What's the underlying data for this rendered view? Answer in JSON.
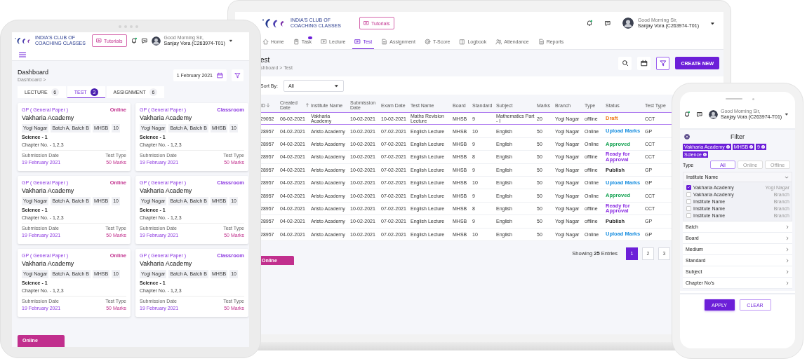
{
  "tablet": {
    "header": {
      "logo_text": [
        "INDIA'S CLUB OF",
        "COACHING CLASSES"
      ],
      "tutorials": "Tutorials",
      "greeting": "Good Morning Sir,",
      "user_name": "Sanjay Vora (C263974-T01)"
    },
    "page_title": "Dashboard",
    "breadcrumb": "Dashboard >",
    "date": "1 February 2021",
    "tabs": [
      {
        "label": "LECTURE",
        "count": "6",
        "selected": false
      },
      {
        "label": "TEST",
        "count": "3",
        "selected": true
      },
      {
        "label": "ASSIGNMENT",
        "count": "6",
        "selected": false
      }
    ],
    "cards": [
      {
        "paper": "GP ( General Paper )",
        "mode": "Online",
        "color": "#c12f8d",
        "title": "Vakharia Academy",
        "chips": [
          "Yogi Nagar",
          "Batch A, Batch B",
          "MHSB",
          "10"
        ],
        "subject": "Science - 1",
        "chapter": "Chapter No. - 1,2,3",
        "date_label": "Submission Date",
        "type_label": "Test Type",
        "date": "19 February 2021",
        "marks": "50 Marks"
      },
      {
        "paper": "GP ( General Paper )",
        "mode": "Classroom",
        "color": "#8a35e0",
        "title": "Vakharia Academy",
        "chips": [
          "Yogi Nagar",
          "Batch A, Batch B",
          "MHSB",
          "10"
        ],
        "subject": "Science - 1",
        "chapter": "Chapter No. - 1,2,3",
        "date_label": "Submission Date",
        "type_label": "Test Type",
        "date": "19 February 2021",
        "marks": "50 Marks"
      },
      {
        "paper": "GP ( General Paper )",
        "mode": "Online",
        "color": "#c12f8d",
        "title": "Vakharia Academy",
        "chips": [
          "Yogi Nagar",
          "Batch A, Batch B",
          "MHSB",
          "10"
        ],
        "subject": "Science - 1",
        "chapter": "Chapter No. - 1,2,3",
        "date_label": "Submission Date",
        "type_label": "Test Type",
        "date": "19 February 2021",
        "marks": "50 Marks"
      },
      {
        "paper": "GP ( General Paper )",
        "mode": "Classroom",
        "color": "#8a35e0",
        "title": "Vakharia Academy",
        "chips": [
          "Yogi Nagar",
          "Batch A, Batch B",
          "MHSB",
          "10"
        ],
        "subject": "Science - 1",
        "chapter": "Chapter No. - 1,2,3",
        "date_label": "Submission Date",
        "type_label": "Test Type",
        "date": "19 February 2021",
        "marks": "50 Marks"
      },
      {
        "paper": "GP ( General Paper )",
        "mode": "Online",
        "color": "#c12f8d",
        "title": "Vakharia Academy",
        "chips": [
          "Yogi Nagar",
          "Batch A, Batch B",
          "MHSB",
          "10"
        ],
        "subject": "Science - 1",
        "chapter": "Chapter No. - 1,2,3",
        "date_label": "Submission Date",
        "type_label": "Test Type",
        "date": "19 February 2021",
        "marks": "50 Marks"
      },
      {
        "paper": "GP ( General Paper )",
        "mode": "Classroom",
        "color": "#8a35e0",
        "title": "Vakharia Academy",
        "chips": [
          "Yogi Nagar",
          "Batch A, Batch B",
          "MHSB",
          "10"
        ],
        "subject": "Science - 1",
        "chapter": "Chapter No. - 1,2,3",
        "date_label": "Submission Date",
        "type_label": "Test Type",
        "date": "19 February 2021",
        "marks": "50 Marks"
      }
    ],
    "bottom_tab": "Online"
  },
  "laptop": {
    "header": {
      "logo_text": [
        "INDIA'S CLUB OF",
        "COACHING CLASSES"
      ],
      "tutorials": "Tutorials",
      "greeting": "Good Morning Sir,",
      "user_name": "Sanjay Vora (C263974-T01)"
    },
    "nav": [
      {
        "label": "Home",
        "selected": false
      },
      {
        "label": "Task",
        "selected": false
      },
      {
        "label": "Lecture",
        "selected": false
      },
      {
        "label": "Test",
        "selected": true
      },
      {
        "label": "Assignment",
        "selected": false
      },
      {
        "label": "T-Score",
        "selected": false
      },
      {
        "label": "Logbook",
        "selected": false
      },
      {
        "label": "Attendance",
        "selected": false
      },
      {
        "label": "Reports",
        "selected": false
      }
    ],
    "page_title": "est",
    "breadcrumb": "shboard > Test",
    "create_button": "CREATE NEW",
    "sort_label": "Sort By:",
    "sort_value": "All",
    "table": {
      "columns": [
        "ID",
        "Created Date",
        "Institute Name",
        "Submission Date",
        "Exam Date",
        "Test Name",
        "Board",
        "Standard",
        "Subject",
        "Marks",
        "Branch",
        "Type",
        "Status",
        "Test Type"
      ],
      "rows": [
        {
          "selected": true,
          "cells": [
            "29052",
            "06-02-2021",
            "Vakharia Academy",
            "10-02-2021",
            "10-02-2021",
            "Maths Revision Lecture",
            "MHSB",
            "9",
            "Mathematics Part - I",
            "20",
            "Yogi Nagar",
            "offline"
          ],
          "status": "Draft",
          "color": "#f07a1a",
          "test_type": "CCT"
        },
        {
          "selected": false,
          "cells": [
            "28957",
            "04-02-2021",
            "Aristo Academy",
            "10-02-2021",
            "07-02-2021",
            "English Lecture",
            "MHSB",
            "10",
            "English",
            "50",
            "Yogi Nagar",
            "Online"
          ],
          "status": "Upload Marks",
          "color": "#1a8fe0",
          "test_type": "GP"
        },
        {
          "selected": false,
          "cells": [
            "28957",
            "04-02-2021",
            "Aristo Academy",
            "10-02-2021",
            "07-02-2021",
            "English Lecture",
            "MHSB",
            "9",
            "English",
            "50",
            "Yogi Nagar",
            "Online"
          ],
          "status": "Approved",
          "color": "#12a150",
          "test_type": "CCT"
        },
        {
          "selected": false,
          "cells": [
            "28957",
            "04-02-2021",
            "Aristo Academy",
            "10-02-2021",
            "07-02-2021",
            "English Lecture",
            "MHSB",
            "8",
            "English",
            "50",
            "Yogi Nagar",
            "offline"
          ],
          "status": "Ready for Approval",
          "color": "#8a2be2",
          "test_type": "CCT"
        },
        {
          "selected": false,
          "cells": [
            "28957",
            "04-02-2021",
            "Aristo Academy",
            "10-02-2021",
            "07-02-2021",
            "English Lecture",
            "MHSB",
            "9",
            "English",
            "50",
            "Yogi Nagar",
            "offline"
          ],
          "status": "Publish",
          "color": "#222222",
          "test_type": "GP"
        },
        {
          "selected": false,
          "cells": [
            "28957",
            "04-02-2021",
            "Aristo Academy",
            "10-02-2021",
            "07-02-2021",
            "English Lecture",
            "MHSB",
            "10",
            "English",
            "50",
            "Yogi Nagar",
            "Online"
          ],
          "status": "Upload Marks",
          "color": "#1a8fe0",
          "test_type": "GP"
        },
        {
          "selected": false,
          "cells": [
            "28957",
            "04-02-2021",
            "Aristo Academy",
            "10-02-2021",
            "07-02-2021",
            "English Lecture",
            "MHSB",
            "9",
            "English",
            "50",
            "Yogi Nagar",
            "Online"
          ],
          "status": "Approved",
          "color": "#12a150",
          "test_type": "CCT"
        },
        {
          "selected": false,
          "cells": [
            "28957",
            "04-02-2021",
            "Aristo Academy",
            "10-02-2021",
            "07-02-2021",
            "English Lecture",
            "MHSB",
            "8",
            "English",
            "50",
            "Yogi Nagar",
            "offline"
          ],
          "status": "Ready for Approval",
          "color": "#8a2be2",
          "test_type": "CCT"
        },
        {
          "selected": false,
          "cells": [
            "28957",
            "04-02-2021",
            "Aristo Academy",
            "10-02-2021",
            "07-02-2021",
            "English Lecture",
            "MHSB",
            "9",
            "English",
            "50",
            "Yogi Nagar",
            "offline"
          ],
          "status": "Publish",
          "color": "#222222",
          "test_type": "GP"
        },
        {
          "selected": false,
          "cells": [
            "28957",
            "04-02-2021",
            "Aristo Academy",
            "10-02-2021",
            "07-02-2021",
            "English Lecture",
            "MHSB",
            "10",
            "English",
            "50",
            "Yogi Nagar",
            "Online"
          ],
          "status": "Upload Marks",
          "color": "#1a8fe0",
          "test_type": "GP"
        }
      ]
    },
    "bottom_tab": "Online",
    "summary": "Showing **25** Entries",
    "pages": [
      {
        "label": "1",
        "selected": true
      },
      {
        "label": "2",
        "selected": false
      },
      {
        "label": "3",
        "selected": false
      }
    ]
  },
  "phone": {
    "greeting": "Good Morning Sir,",
    "user_name": "Sanjay Vora (C263974-T01)",
    "filter_title": "Filter",
    "chips": [
      "Vakharia Academy",
      "MHSB",
      "9",
      "Science"
    ],
    "type_label": "Type",
    "types": [
      {
        "label": "All",
        "selected": true
      },
      {
        "label": "Online",
        "selected": false
      },
      {
        "label": "Offline",
        "selected": false
      }
    ],
    "institute": {
      "title": "Institute Name",
      "expanded": true,
      "items": [
        {
          "name": "Vakharia Academy",
          "branch": "Yogi Nagar",
          "checked": true
        },
        {
          "name": "Vakharia Academy",
          "branch": "Branch",
          "checked": false
        },
        {
          "name": "Institute Name",
          "branch": "Branch",
          "checked": false
        },
        {
          "name": "Institute Name",
          "branch": "Branch",
          "checked": false
        },
        {
          "name": "Institute Name",
          "branch": "Branch",
          "checked": false
        }
      ]
    },
    "sections": [
      "Batch",
      "Board",
      "Medium",
      "Standard",
      "Subject",
      "Chapter No's"
    ],
    "apply": "APPLY",
    "clear": "CLEAR"
  }
}
